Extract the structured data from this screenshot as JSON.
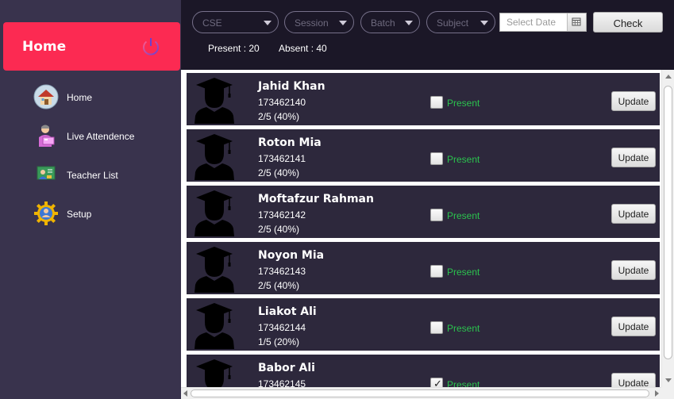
{
  "sidebar": {
    "header_title": "Home",
    "items": [
      {
        "label": "Home",
        "icon": "house-icon"
      },
      {
        "label": "Live Attendence",
        "icon": "teacher-presentation-icon"
      },
      {
        "label": "Teacher List",
        "icon": "teacher-board-icon"
      },
      {
        "label": "Setup",
        "icon": "gear-user-icon"
      }
    ]
  },
  "filters": {
    "department": "CSE",
    "session": "Session",
    "batch": "Batch",
    "subject": "Subject",
    "date_placeholder": "Select Date",
    "check_label": "Check"
  },
  "stats": {
    "present": "Present : 20",
    "absent": "Absent : 40"
  },
  "students": [
    {
      "name": "Jahid Khan",
      "id": "173462140",
      "ratio": "2/5 (40%)",
      "status_label": "Present",
      "checked": false,
      "button": "Update"
    },
    {
      "name": "Roton Mia",
      "id": "173462141",
      "ratio": "2/5 (40%)",
      "status_label": "Present",
      "checked": false,
      "button": "Update"
    },
    {
      "name": "Moftafzur Rahman",
      "id": "173462142",
      "ratio": "2/5 (40%)",
      "status_label": "Present",
      "checked": false,
      "button": "Update"
    },
    {
      "name": "Noyon Mia",
      "id": "173462143",
      "ratio": "2/5 (40%)",
      "status_label": "Present",
      "checked": false,
      "button": "Update"
    },
    {
      "name": "Liakot Ali",
      "id": "173462144",
      "ratio": "1/5 (20%)",
      "status_label": "Present",
      "checked": false,
      "button": "Update"
    },
    {
      "name": "Babor Ali",
      "id": "173462145",
      "ratio": "",
      "status_label": "Present",
      "checked": true,
      "button": "Update"
    }
  ],
  "colors": {
    "accent": "#fc2a52",
    "sidebar": "#39334d",
    "topbar": "#1b1727",
    "card": "#2d283c",
    "present_text": "#2bc24e"
  }
}
